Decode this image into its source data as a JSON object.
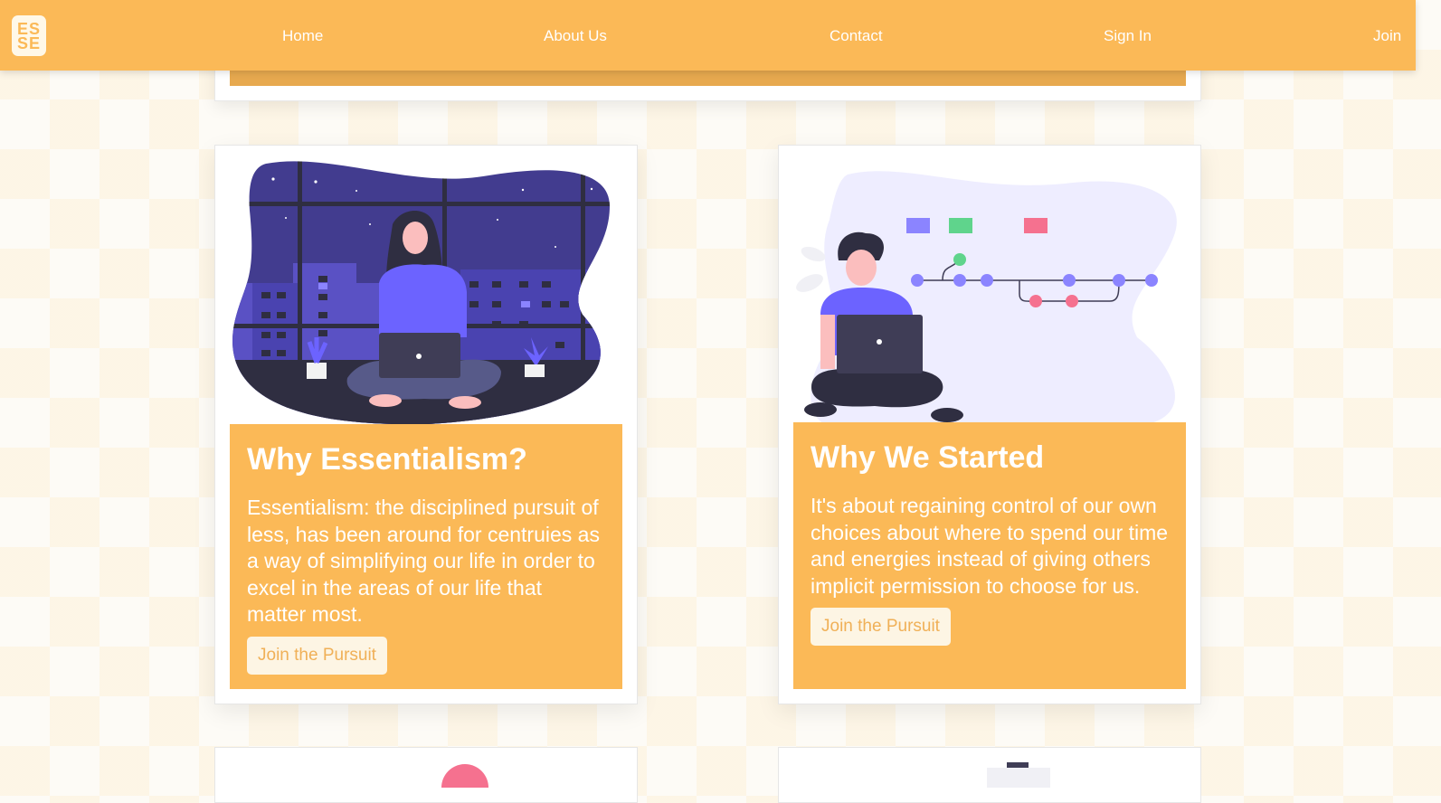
{
  "nav": {
    "logo_line1": "ES",
    "logo_line2": "SE",
    "links": [
      "Home",
      "About Us",
      "Contact",
      "Sign In",
      "Join"
    ]
  },
  "cards": [
    {
      "title": "Why Essentialism?",
      "text": "Essentialism: the disciplined pursuit of less, has been around for centruies as a way of simplifying our life in order to excel in the areas of our life that matter most.",
      "button": "Join the Pursuit",
      "illustration": "woman-laptop-night-window-icon"
    },
    {
      "title": "Why We Started",
      "text": "It's about regaining control of our own choices about where to spend our time and energies instead of giving others implicit permission to choose for us.",
      "button": "Join the Pursuit",
      "illustration": "man-laptop-flowchart-icon"
    }
  ],
  "colors": {
    "accent": "#fbb957",
    "purple": "#6c63ff",
    "dark": "#3f3d56"
  }
}
